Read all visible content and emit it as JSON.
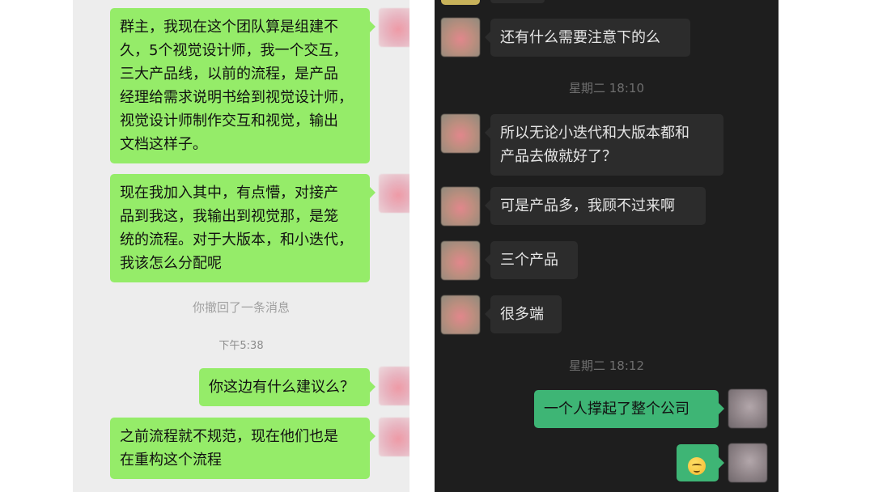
{
  "left_chat": {
    "messages": [
      {
        "text": "群主，我现在这个团队算是组建不\n久，5个视觉设计师，我一个交互，\n三大产品线，以前的流程，是产品\n经理给需求说明书给到视觉设计师，\n视觉设计师制作交互和视觉，输出\n文档这样子。"
      },
      {
        "text": "现在我加入其中，有点懵，对接产\n品到我这，我输出到视觉那，是笼\n统的流程。对于大版本，和小迭代，\n我该怎么分配呢"
      },
      {
        "text": "你这边有什么建议么？"
      },
      {
        "text": "之前流程就不规范，现在他们也是\n在重构这个流程"
      }
    ],
    "recall_notice": "你撤回了一条消息",
    "timestamp": "下午5:38"
  },
  "right_chat": {
    "messages": [
      {
        "text": "还有什么需要注意下的么"
      },
      {
        "text": "所以无论小迭代和大版本都和\n产品去做就好了？"
      },
      {
        "text": "可是产品多，我顾不过来啊"
      },
      {
        "text": "三个产品"
      },
      {
        "text": "很多端"
      },
      {
        "text": "一个人撑起了整个公司"
      }
    ],
    "timestamps": [
      "星期二 18:10",
      "星期二 18:12"
    ],
    "emoji": "smiling-face-emoji"
  },
  "colors": {
    "light_bg": "#ededed",
    "dark_bg": "#1e1e1e",
    "green_bubble": "#95ec69",
    "dark_green_bubble": "#3eb575",
    "dark_bubble": "#2c2c2c"
  }
}
